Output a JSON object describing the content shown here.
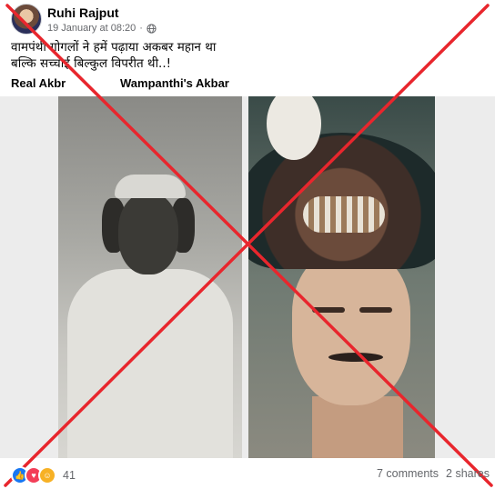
{
  "post": {
    "author": "Ruhi Rajput",
    "timestamp": "19 January at 08:20",
    "privacy_icon": "globe-icon",
    "caption_line1": "वामपंथी गोगलों ने हमें पढ़ाया अकबर महान था",
    "caption_line2": "बल्कि सच्चाई बिल्कुल विपरीत थी..!",
    "label_left": "Real Akbr",
    "label_right": "Wampanthi's Akbar"
  },
  "overlay": {
    "x_color": "#e8262d"
  },
  "footer": {
    "reaction_icons": [
      "like-icon",
      "love-icon",
      "haha-icon"
    ],
    "reaction_count": "41",
    "comments": "7 comments",
    "shares": "2 shares"
  }
}
